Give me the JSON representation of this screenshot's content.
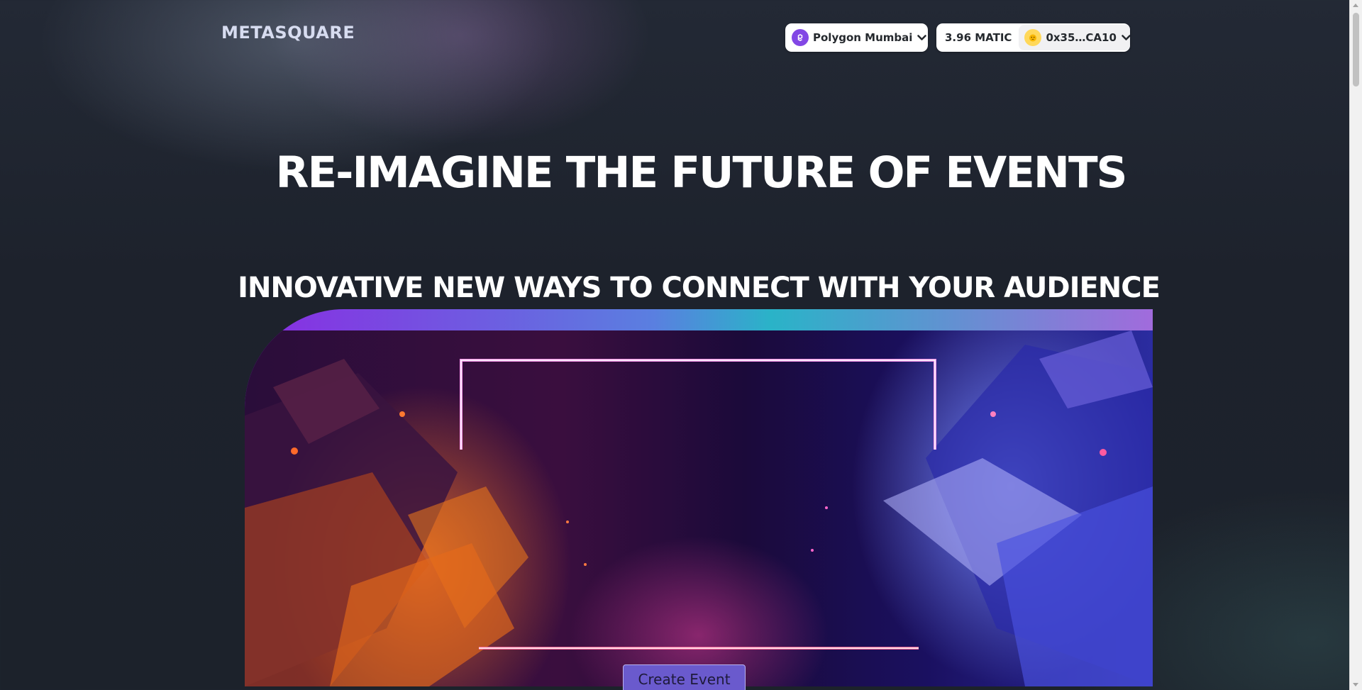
{
  "header": {
    "logo": "METASQUARE",
    "network_button": {
      "label": "Polygon Mumbai",
      "icon": "polygon-icon"
    },
    "account_button": {
      "balance": "3.96 MATIC",
      "address": "0x35…CA10",
      "avatar_icon": "emoji-avatar-icon"
    }
  },
  "hero": {
    "headline": "RE-IMAGINE THE FUTURE OF EVENTS",
    "subheadline": "INNOVATIVE NEW WAYS TO CONNECT WITH YOUR AUDIENCE",
    "cta_label": "Create Event"
  },
  "colors": {
    "background": "#1d222c",
    "logo_text": "#d7dcf0",
    "polygon_purple": "#8247e5",
    "cta_background": "#6a5acd"
  }
}
